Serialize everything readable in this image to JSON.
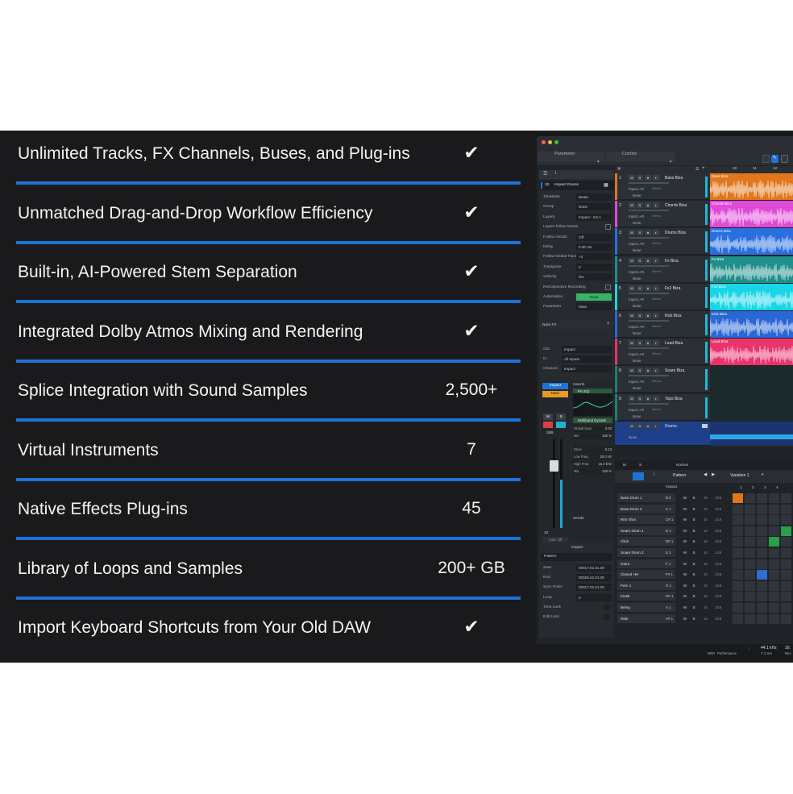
{
  "features": [
    {
      "label": "Unlimited Tracks, FX Channels, Buses, and Plug-ins",
      "value": "✔"
    },
    {
      "label": "Unmatched Drag-and-Drop Workflow Efficiency",
      "value": "✔"
    },
    {
      "label": "Built-in, AI-Powered Stem Separation",
      "value": "✔"
    },
    {
      "label": "Integrated Dolby Atmos Mixing and Rendering",
      "value": "✔"
    },
    {
      "label": "Splice Integration with Sound Samples",
      "value": "2,500+"
    },
    {
      "label": "Virtual Instruments",
      "value": "7"
    },
    {
      "label": "Native Effects Plug-ins",
      "value": "45"
    },
    {
      "label": "Library of Loops and Samples",
      "value": "200+ GB"
    },
    {
      "label": "Import Keyboard Shortcuts from Your Old DAW",
      "value": "✔"
    }
  ],
  "colors": {
    "accent": "#1f73d6",
    "banner_bg": "#1a1a1c"
  },
  "daw": {
    "tabs": {
      "parameter": "Parameter",
      "control": "Control"
    },
    "inspector": {
      "track_number": "10",
      "track_name": "Impact Drums",
      "rows": [
        {
          "k": "Timebase",
          "v": "Beats"
        },
        {
          "k": "Group",
          "v": "None"
        },
        {
          "k": "Layers",
          "v": "Impact - ms 1"
        },
        {
          "k": "Layers follow events",
          "v": ""
        },
        {
          "k": "Follow chords",
          "v": "Off"
        },
        {
          "k": "Delay",
          "v": "0.00 ms"
        },
        {
          "k": "Follow Global Transpose",
          "v": "+2"
        },
        {
          "k": "Transpose",
          "v": "0"
        },
        {
          "k": "Velocity",
          "v": "0%"
        },
        {
          "k": "Retrospective Recording",
          "v": ""
        },
        {
          "k": "Automation",
          "v": "Read"
        },
        {
          "k": "Parameter",
          "v": "Mute"
        }
      ],
      "note_fx": "Note FX",
      "routing": [
        {
          "k": "Out",
          "v": "Impact"
        },
        {
          "k": "In",
          "v": "All Inputs"
        },
        {
          "k": "Channel",
          "v": "Impact"
        }
      ],
      "channel_name": "Impact",
      "channel_main": "Main",
      "inserts_label": "Inserts",
      "inserts": [
        "Pro EQ",
        "Multiband Dynami",
        "RedlightDist"
      ],
      "insert_params": [
        {
          "k": "Global Gain",
          "v": "0.00"
        },
        {
          "k": "Mix",
          "v": "100 %"
        },
        {
          "k": "Drive",
          "v": "5.13"
        },
        {
          "k": "Low Freq",
          "v": "20.0 Hz"
        },
        {
          "k": "High Freq",
          "v": "15.0 kHz"
        },
        {
          "k": "Mix",
          "v": "100 %"
        }
      ],
      "sends_label": "Sends",
      "level": "0dB",
      "fader_number": "10",
      "auto_off": "Auto: Off",
      "channel_footer": "Impact",
      "pattern_label": "Pattern",
      "pattern_rows": [
        {
          "k": "Start",
          "v": "00017.01.01.00"
        },
        {
          "k": "End",
          "v": "00025.01.01.00"
        },
        {
          "k": "Sync Point",
          "v": "00017.01.01.00"
        },
        {
          "k": "Loop",
          "v": "0"
        },
        {
          "k": "Time Lock",
          "v": ""
        },
        {
          "k": "Edit Lock",
          "v": ""
        }
      ]
    },
    "ruler": [
      "10",
      "11",
      "12",
      "13"
    ],
    "tracks": [
      {
        "num": "1",
        "name": "Bass Biza",
        "clip": "Bass Biza",
        "color": "#e0771c"
      },
      {
        "num": "2",
        "name": "Chords Biza",
        "clip": "Chords Biza",
        "color": "#e04ad8"
      },
      {
        "num": "3",
        "name": "Drums Biza",
        "clip": "Drums Biza",
        "color": "#2a6fe0"
      },
      {
        "num": "4",
        "name": "Fx Biza",
        "clip": "Fx Biza",
        "color": "#1f8f8a"
      },
      {
        "num": "5",
        "name": "Fx2 Biza",
        "clip": "Fx2 Biza",
        "color": "#18d6e6"
      },
      {
        "num": "6",
        "name": "Kick Biza",
        "clip": "Kick Biza",
        "color": "#2a67d6"
      },
      {
        "num": "7",
        "name": "Lead Biza",
        "clip": "Lead Biza",
        "color": "#e8336e"
      },
      {
        "num": "8",
        "name": "Snare Biza",
        "clip": "",
        "color": "#1f7f74"
      },
      {
        "num": "9",
        "name": "Tops Biza",
        "clip": "",
        "color": "#1f7f74"
      }
    ],
    "track_input": "Input L+R",
    "track_input_mode": "Stereo",
    "track_none": "None",
    "folder_track": {
      "name": "Drums",
      "none": "None"
    },
    "pattern_editor": {
      "title": "Pattern",
      "variation": "Variation 1",
      "instrument": "Impact",
      "mode": "Normal",
      "steps": [
        "1",
        "2",
        "3",
        "4"
      ],
      "rows": [
        {
          "name": "Bass Drum 1",
          "note": "B 0",
          "v1": "16",
          "v2": "1/16",
          "color": "#e0771c",
          "on": [
            0
          ]
        },
        {
          "name": "Bass Drum 2",
          "note": "C 1",
          "v1": "16",
          "v2": "1/16",
          "color": "#e0771c",
          "on": []
        },
        {
          "name": "Rim Shot",
          "note": "C# 1",
          "v1": "16",
          "v2": "1/16",
          "color": "#2a9f4a",
          "on": []
        },
        {
          "name": "Snare Drum 1",
          "note": "D 1",
          "v1": "16",
          "v2": "1/16",
          "color": "#2a9f4a",
          "on": [
            4
          ]
        },
        {
          "name": "Click",
          "note": "D# 1",
          "v1": "16",
          "v2": "1/16",
          "color": "#2a9f4a",
          "on": [
            3
          ]
        },
        {
          "name": "Snare Drum 2",
          "note": "E 1",
          "v1": "16",
          "v2": "1/16",
          "color": "#2a9f4a",
          "on": []
        },
        {
          "name": "Guiro",
          "note": "F 1",
          "v1": "16",
          "v2": "1/16",
          "color": "#2f6fd0",
          "on": []
        },
        {
          "name": "Closed HH",
          "note": "F# 1",
          "v1": "16",
          "v2": "1/16",
          "color": "#2f6fd0",
          "on": [
            2
          ]
        },
        {
          "name": "Perc 1",
          "note": "G 1",
          "v1": "16",
          "v2": "1/16",
          "color": "#2f6fd0",
          "on": []
        },
        {
          "name": "Kiosk",
          "note": "G# 1",
          "v1": "16",
          "v2": "1/16",
          "color": "#2f6fd0",
          "on": []
        },
        {
          "name": "Being",
          "note": "A 1",
          "v1": "16",
          "v2": "1/16",
          "color": "#2f6fd0",
          "on": []
        },
        {
          "name": "Ride",
          "note": "A# 1",
          "v1": "16",
          "v2": "1/16",
          "color": "#2f6fd0",
          "on": []
        }
      ]
    },
    "status": {
      "midi": "MIDI",
      "performance": "Performance",
      "sample_rate": "44.1 kHz",
      "latency": "7.1 ms",
      "tail1": "16:",
      "tail2": "Rec"
    }
  }
}
